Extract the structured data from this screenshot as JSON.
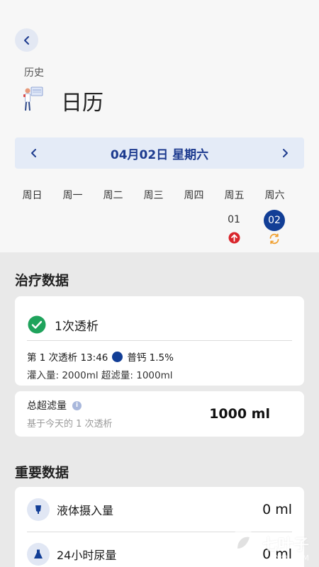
{
  "header": {
    "back_icon": "chevron-left-icon",
    "breadcrumb": "历史",
    "title": "日历"
  },
  "date_bar": {
    "title": "04月02日 星期六",
    "prev_icon": "chevron-left-icon",
    "next_icon": "chevron-right-icon"
  },
  "calendar": {
    "weekdays": [
      "周日",
      "周一",
      "周二",
      "周三",
      "周四",
      "周五",
      "周六"
    ],
    "days": [
      {
        "num": "01",
        "mark": "red-up-arrow-icon",
        "selected": false
      },
      {
        "num": "02",
        "mark": "orange-sync-icon",
        "selected": true
      }
    ]
  },
  "treatment": {
    "section_title": "治疗数据",
    "dialysis_label": "1次透析",
    "detail_prefix": "第 1 次透析 13:46",
    "detail_solution": "普钙 1.5%",
    "detail_line2": "灌入量: 2000ml  超滤量: 1000ml",
    "uf_label": "总超滤量",
    "uf_sub": "基于今天的 1 次透析",
    "uf_value": "1000 ml"
  },
  "vitals": {
    "section_title": "重要数据",
    "items": [
      {
        "label": "液体摄入量",
        "value": "0 ml",
        "icon": "drink-cup-icon"
      },
      {
        "label": "24小时尿量",
        "value": "0 ml",
        "icon": "flask-icon"
      }
    ]
  },
  "watermark": {
    "text": "七叶子",
    "sub": "7Y**.COM"
  },
  "colors": {
    "accent": "#123e96",
    "success": "#1fa35c",
    "alert": "#d9262c",
    "sync": "#f0a030"
  }
}
